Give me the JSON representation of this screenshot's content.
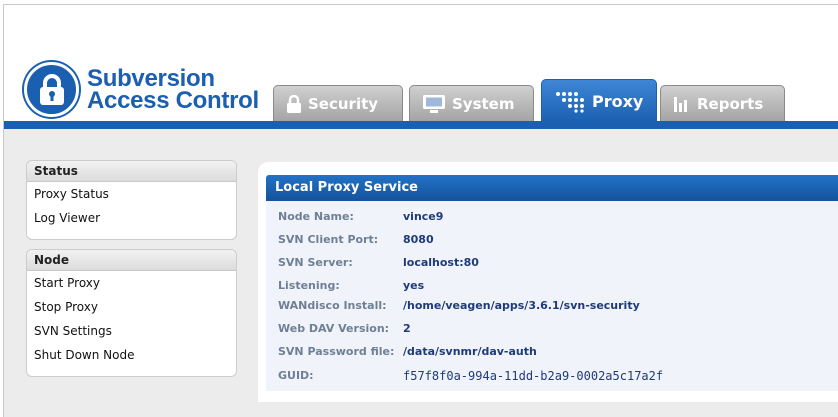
{
  "app": {
    "logo_line1": "Subversion",
    "logo_line2": "Access Control",
    "brand_color": "#1a5fb0"
  },
  "tabs": [
    {
      "label": "Security",
      "icon": "lock-icon",
      "active": false
    },
    {
      "label": "System",
      "icon": "monitor-icon",
      "active": false
    },
    {
      "label": "Proxy",
      "icon": "network-dots-icon",
      "active": true
    },
    {
      "label": "Reports",
      "icon": "bar-chart-icon",
      "active": false
    }
  ],
  "sidebar": {
    "status": {
      "title": "Status",
      "items": [
        "Proxy Status",
        "Log Viewer"
      ]
    },
    "node": {
      "title": "Node",
      "items": [
        "Start Proxy",
        "Stop Proxy",
        "SVN Settings",
        "Shut Down Node"
      ]
    }
  },
  "panel": {
    "title": "Local Proxy Service",
    "rows": [
      {
        "label": "Node Name:",
        "value": "vince9"
      },
      {
        "label": "SVN Client Port:",
        "value": "8080"
      },
      {
        "label": "SVN Server:",
        "value": "localhost:80"
      },
      {
        "label": "Listening:",
        "value": "yes"
      },
      {
        "label": "WANdisco Install:",
        "value": "/home/veagen/apps/3.6.1/svn-security"
      },
      {
        "label": "Web DAV Version:",
        "value": "2"
      },
      {
        "label": "SVN Password file:",
        "value": "/data/svnmr/dav-auth"
      },
      {
        "label": "GUID:",
        "value": "f57f8f0a-994a-11dd-b2a9-0002a5c17a2f"
      }
    ]
  }
}
